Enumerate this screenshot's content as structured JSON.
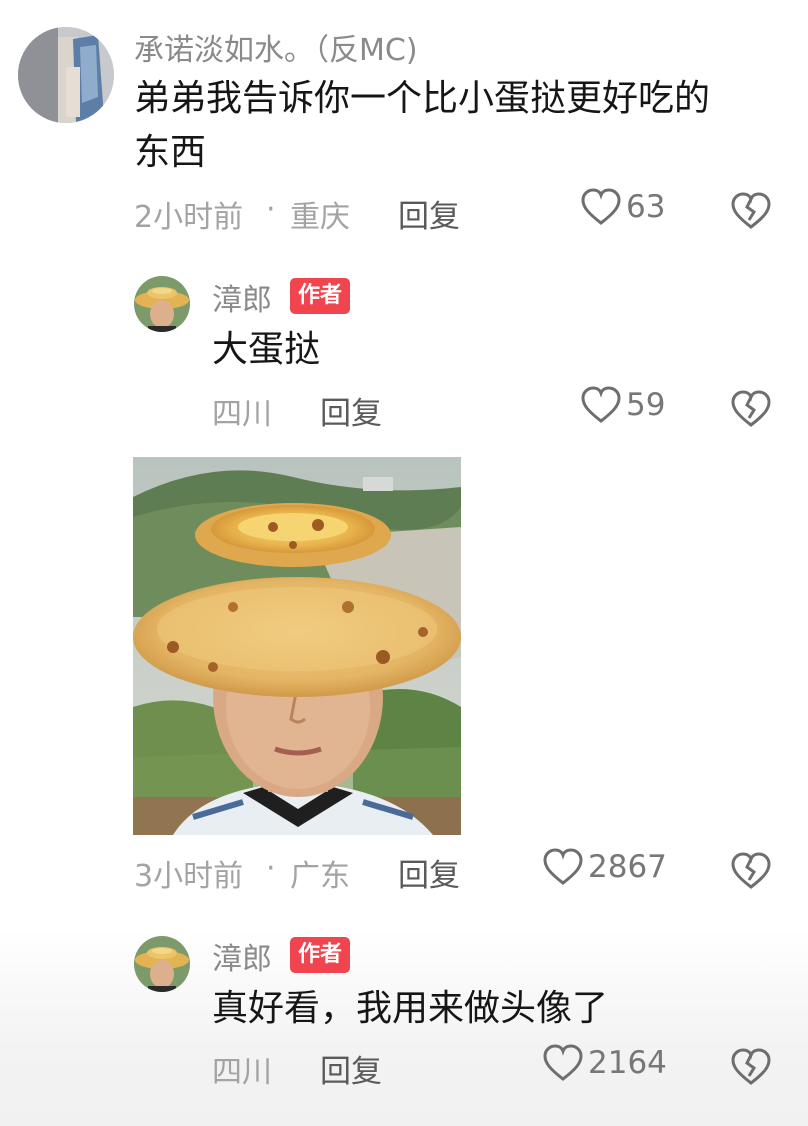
{
  "comments": [
    {
      "user": "承诺淡如水。（反MC)",
      "text_line1": "弟弟我告诉你一个比小蛋挞更好吃的",
      "text_line2": "东西",
      "time": "2小时前",
      "location": "重庆",
      "reply": "回复",
      "likes": "63"
    }
  ],
  "replies": [
    {
      "user": "漳郎",
      "badge": "作者",
      "text": "大蛋挞",
      "location": "四川",
      "reply": "回复",
      "likes": "59",
      "image_time": "3小时前",
      "image_location": "广东",
      "image_reply": "回复",
      "image_likes": "2867"
    },
    {
      "user": "漳郎",
      "badge": "作者",
      "text": "真好看，我用来做头像了",
      "location": "四川",
      "reply": "回复",
      "likes": "2164"
    }
  ],
  "separator": "·",
  "icons": {
    "like": "heart-outline-icon",
    "dislike": "broken-heart-icon"
  },
  "colors": {
    "badge": "#f0444f",
    "meta": "#a3a3a3"
  }
}
